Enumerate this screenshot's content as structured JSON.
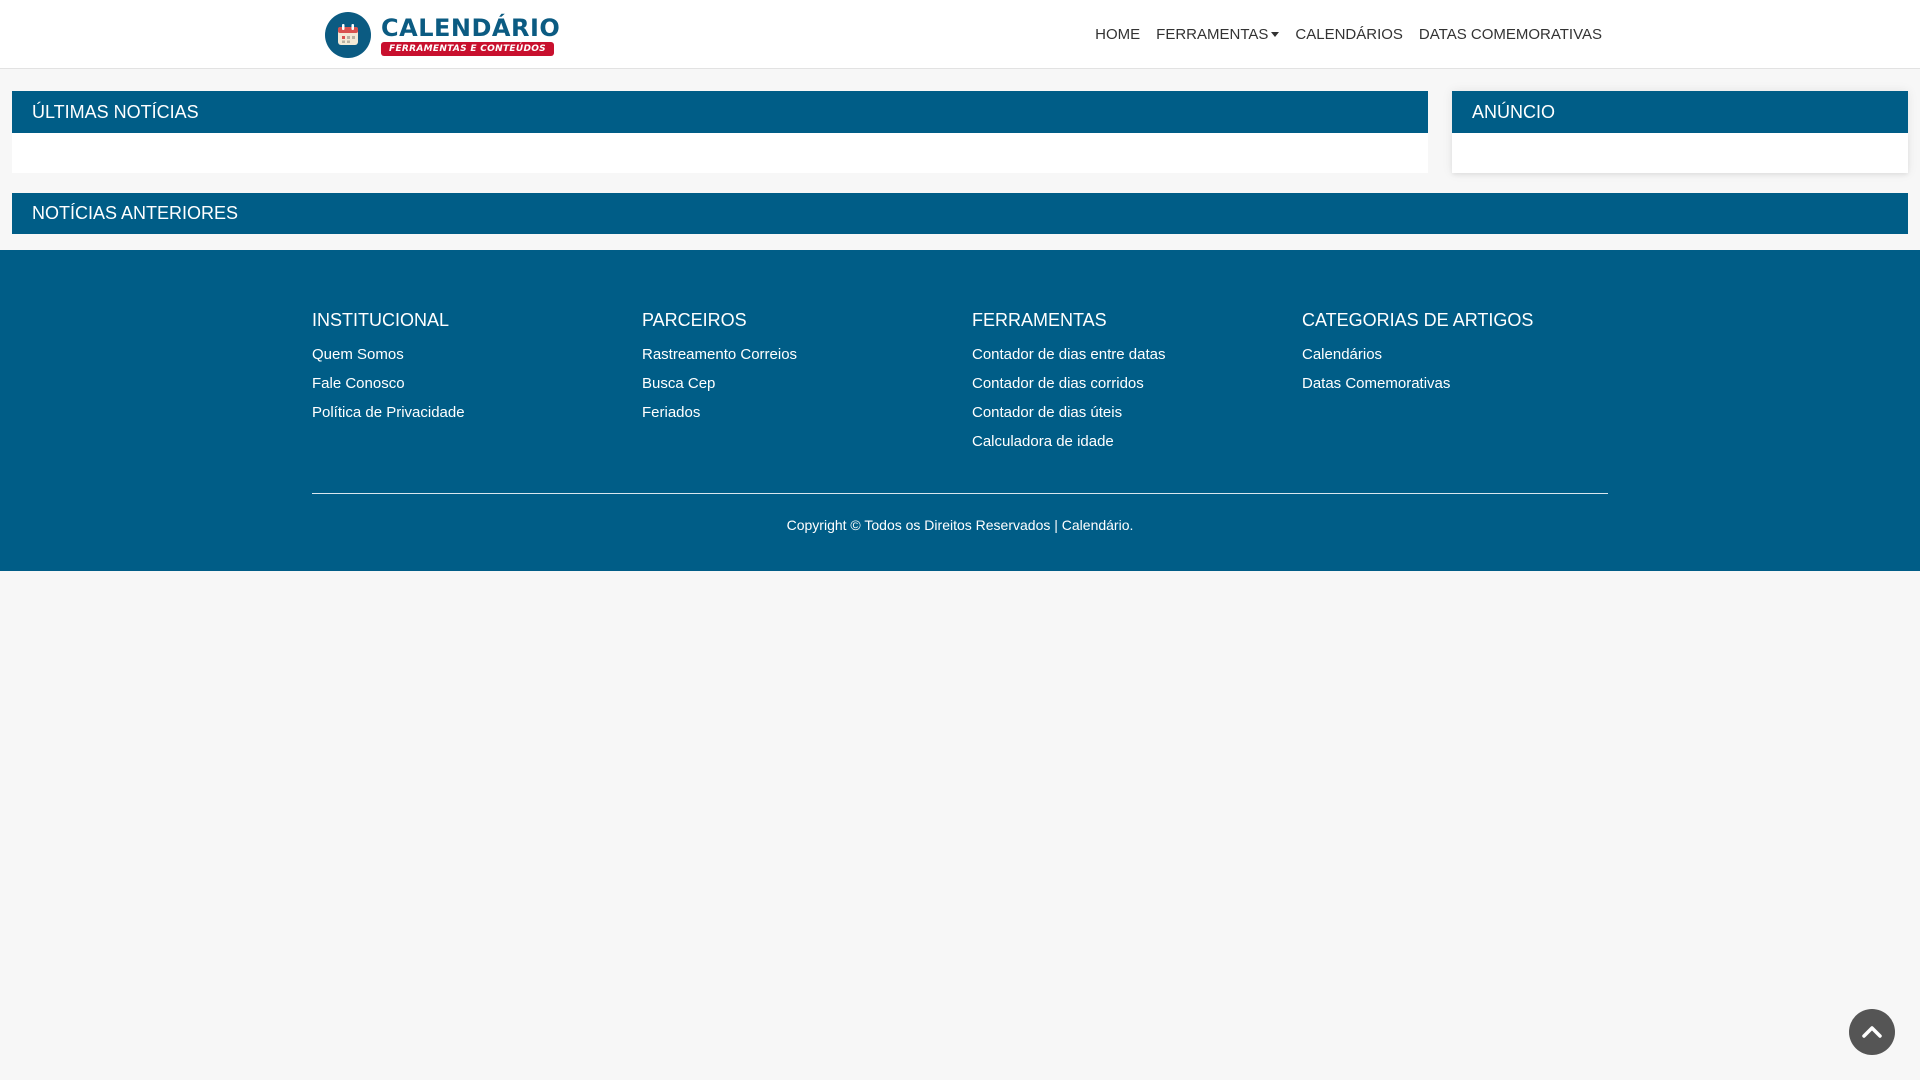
{
  "header": {
    "logo": {
      "title": "CALENDÁRIO",
      "subtitle": "FERRAMENTAS E CONTEÚDOS",
      "icon": "calendar-icon"
    },
    "nav": [
      {
        "label": "HOME"
      },
      {
        "label": "FERRAMENTAS",
        "dropdown": true
      },
      {
        "label": "CALENDÁRIOS"
      },
      {
        "label": "DATAS COMEMORATIVAS"
      }
    ]
  },
  "main": {
    "ultimas_noticias": "ÚLTIMAS NOTÍCIAS",
    "anuncio": "ANÚNCIO",
    "noticias_anteriores": "NOTÍCIAS ANTERIORES"
  },
  "footer": {
    "columns": [
      {
        "title": "INSTITUCIONAL",
        "links": [
          "Quem Somos",
          "Fale Conosco",
          "Política de Privacidade"
        ]
      },
      {
        "title": "PARCEIROS",
        "links": [
          "Rastreamento Correios",
          "Busca Cep",
          "Feriados"
        ]
      },
      {
        "title": "FERRAMENTAS",
        "links": [
          "Contador de dias entre datas",
          "Contador de dias corridos",
          "Contador de dias úteis",
          "Calculadora de idade"
        ]
      },
      {
        "title": "CATEGORIAS DE ARTIGOS",
        "links": [
          "Calendários",
          "Datas Comemorativas"
        ]
      }
    ],
    "copyright": "Copyright © Todos os Direitos Reservados | Calendário."
  },
  "back_to_top": {
    "icon": "chevron-up-icon"
  },
  "colors": {
    "primary": "#005d87",
    "accent": "#c8102e",
    "background": "#f7f7f7"
  }
}
